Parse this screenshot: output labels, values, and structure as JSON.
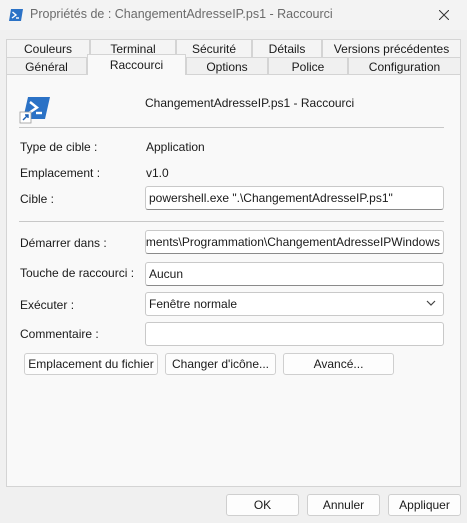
{
  "window": {
    "title": "Propriétés de : ChangementAdresseIP.ps1 - Raccourci"
  },
  "tabs_back": [
    {
      "label": "Couleurs"
    },
    {
      "label": "Terminal"
    },
    {
      "label": "Sécurité"
    },
    {
      "label": "Détails"
    },
    {
      "label": "Versions précédentes"
    }
  ],
  "tabs_front": [
    {
      "label": "Général"
    },
    {
      "label": "Raccourci",
      "active": true
    },
    {
      "label": "Options"
    },
    {
      "label": "Police"
    },
    {
      "label": "Configuration"
    }
  ],
  "header": {
    "name": "ChangementAdresseIP.ps1 - Raccourci",
    "icon": "powershell-shortcut-icon"
  },
  "fields": {
    "target_type": {
      "label": "Type de cible :",
      "value": "Application"
    },
    "location": {
      "label": "Emplacement :",
      "value": "v1.0"
    },
    "target": {
      "label": "Cible :",
      "value": "powershell.exe \".\\ChangementAdresseIP.ps1\""
    },
    "start_in": {
      "label": "Démarrer dans :",
      "value": "C:\\Users\\Documents\\Programmation\\ChangementAdresseIPWindows"
    },
    "shortcut_key": {
      "label": "Touche de raccourci :",
      "value": "Aucun"
    },
    "run": {
      "label": "Exécuter :",
      "value": "Fenêtre normale"
    },
    "comment": {
      "label": "Commentaire :",
      "value": ""
    }
  },
  "buttons": {
    "open_location": "Emplacement du fichier",
    "change_icon": "Changer d'icône...",
    "advanced": "Avancé...",
    "ok": "OK",
    "cancel": "Annuler",
    "apply": "Appliquer"
  },
  "colors": {
    "powershell_blue": "#2b72c6",
    "window_bg": "#f0f0f0",
    "panel_bg": "#f9f9f9"
  }
}
